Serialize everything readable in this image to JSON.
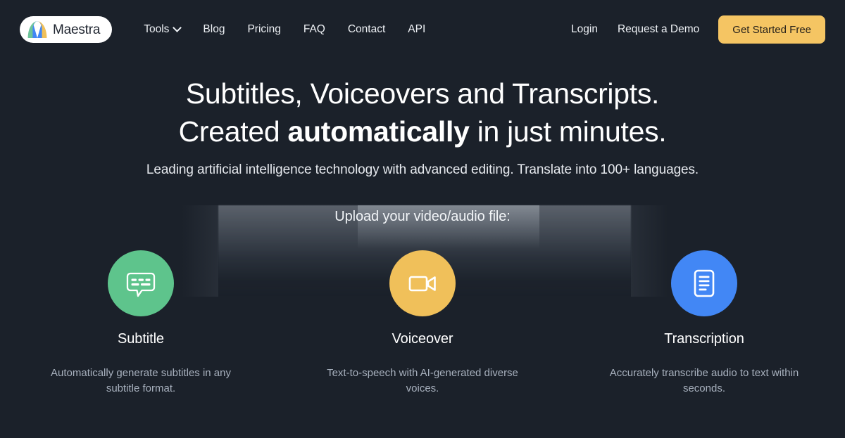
{
  "brand": {
    "name": "Maestra",
    "logo_icon": "maestra-arch-logo",
    "logo_colors": {
      "green": "#6dc49a",
      "blue": "#4287f5",
      "yellow": "#f0c05a"
    }
  },
  "colors": {
    "background": "#1b212a",
    "cta": "#f5c563",
    "subtitle_circle": "#5ec48c",
    "voiceover_circle": "#f0c05a",
    "transcription_circle": "#4287f5",
    "muted_text": "#a7b0bd"
  },
  "nav": {
    "links": [
      {
        "label": "Tools",
        "icon": "chevron-down-icon",
        "has_dropdown": true
      },
      {
        "label": "Blog",
        "has_dropdown": false
      },
      {
        "label": "Pricing",
        "has_dropdown": false
      },
      {
        "label": "FAQ",
        "has_dropdown": false
      },
      {
        "label": "Contact",
        "has_dropdown": false
      },
      {
        "label": "API",
        "has_dropdown": false
      }
    ],
    "right": {
      "login_label": "Login",
      "demo_label": "Request a Demo",
      "cta_label": "Get Started Free"
    }
  },
  "hero": {
    "headline_line1": "Subtitles, Voiceovers and Transcripts.",
    "headline_line2_pre": "Created ",
    "headline_line2_bold": "automatically",
    "headline_line2_post": " in just minutes.",
    "subhead": "Leading artificial intelligence technology with advanced editing. Translate into 100+ languages."
  },
  "upload": {
    "title": "Upload your video/audio file:",
    "cards": [
      {
        "title": "Subtitle",
        "description": "Automatically generate subtitles in any subtitle format.",
        "icon": "speech-bubble-subtitles-icon",
        "color": "#5ec48c"
      },
      {
        "title": "Voiceover",
        "description": "Text-to-speech with AI-generated diverse voices.",
        "icon": "video-camera-icon",
        "color": "#f0c05a"
      },
      {
        "title": "Transcription",
        "description": "Accurately transcribe audio to text within seconds.",
        "icon": "document-lines-icon",
        "color": "#4287f5"
      }
    ]
  }
}
